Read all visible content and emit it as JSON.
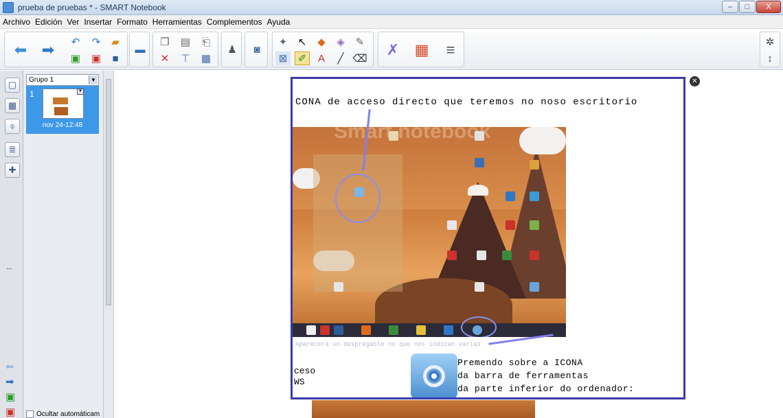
{
  "window": {
    "title": "prueba de pruebas * - SMART Notebook",
    "controls": [
      "–",
      "□",
      "X"
    ]
  },
  "menu": [
    "Archivo",
    "Edición",
    "Ver",
    "Insertar",
    "Formato",
    "Herramientas",
    "Complementos",
    "Ayuda"
  ],
  "sorter": {
    "group": "Grupo 1",
    "page_number": "1",
    "page_date": "nov 24-12:48",
    "autohide_label": "Ocultar automáticam"
  },
  "slide": {
    "heading": "CONA de acceso directo que teremos no noso escritorio",
    "watermark": "Smart notebook",
    "fragment1": "ceso",
    "fragment2": "WS",
    "instruction": [
      "Premendo sobre a ICONA",
      "da barra de ferramentas",
      "da parte inferior do ordenador:"
    ],
    "faded_text": "Aparecerá un despregable no que nos indican varias"
  },
  "colors": {
    "frame": "#3a3aa8",
    "arrow": "#8080e8",
    "sorter_selected": "#3d98e8"
  }
}
